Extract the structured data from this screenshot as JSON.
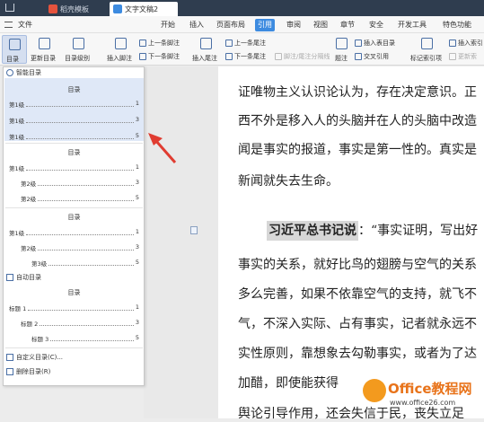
{
  "tabs": [
    {
      "label": "稻壳模板",
      "color": "#e5533d"
    },
    {
      "label": "文字文稿2",
      "color": "#3d8be0"
    }
  ],
  "menubar": {
    "file": "文件",
    "items": [
      "开始",
      "插入",
      "页面布局",
      "引用",
      "审阅",
      "视图",
      "章节",
      "安全",
      "开发工具",
      "特色功能"
    ],
    "active": "引用"
  },
  "ribbon": {
    "toc": "目录",
    "update_toc": "更新目录",
    "toc_level": "目录级别",
    "insert_footnote": "插入脚注",
    "prev_footnote": "上一条脚注",
    "next_footnote": "下一条脚注",
    "insert_endnote": "插入尾注",
    "prev_endnote": "上一条尾注",
    "next_endnote": "下一条尾注",
    "footnote_endnote_sep": "脚注/尾注分隔线",
    "caption": "题注",
    "insert_table_toc": "插入表目录",
    "cross_ref": "交叉引用",
    "mark_index": "标记索引项",
    "insert_index": "插入索引",
    "update_index": "更新索"
  },
  "panel": {
    "smart_toc": "智能目录",
    "auto_toc": "自动目录",
    "custom_toc": "自定义目录(C)...",
    "delete_toc": "删除目录(R)",
    "templates": [
      {
        "title": "目录",
        "lines": [
          {
            "text": "第1级",
            "page": "1",
            "indent": 0
          },
          {
            "text": "第1级",
            "page": "3",
            "indent": 0
          },
          {
            "text": "第1级",
            "page": "5",
            "indent": 0
          }
        ]
      },
      {
        "title": "目录",
        "lines": [
          {
            "text": "第1级",
            "page": "1",
            "indent": 0
          },
          {
            "text": "第2级",
            "page": "3",
            "indent": 1
          },
          {
            "text": "第2级",
            "page": "5",
            "indent": 1
          }
        ]
      },
      {
        "title": "目录",
        "lines": [
          {
            "text": "第1级",
            "page": "1",
            "indent": 0
          },
          {
            "text": "第2级",
            "page": "3",
            "indent": 1
          },
          {
            "text": "第3级",
            "page": "5",
            "indent": 2
          }
        ]
      }
    ],
    "auto": {
      "title": "目录",
      "lines": [
        {
          "text": "标题 1",
          "page": "1",
          "indent": 0
        },
        {
          "text": "标题 2",
          "page": "3",
          "indent": 1
        },
        {
          "text": "标题 3",
          "page": "5",
          "indent": 2
        }
      ]
    }
  },
  "document": {
    "lines": [
      "证唯物主义认识论认为，存在决定意识。正",
      "西不外是移入人的头脑并在人的头脑中改造",
      "闻是事实的报道，事实是第一性的。真实是",
      "新闻就失去生命。",
      "",
      "：“事实证明，写出好",
      "事实的关系，就好比鸟的翅膀与空气的关系",
      "多么完善，如果不依靠空气的支持，就飞不",
      "气，不深入实际、占有事实，记者就永远不",
      "实性原则，靠想象去勾勒事实，或者为了达",
      "加醋，即使能获得",
      "舆论引导作用，还会失信于民，丧失立足"
    ],
    "highlight": "习近平总书记说"
  },
  "watermark": {
    "brand": "Office教程网",
    "url": "www.office26.com"
  }
}
